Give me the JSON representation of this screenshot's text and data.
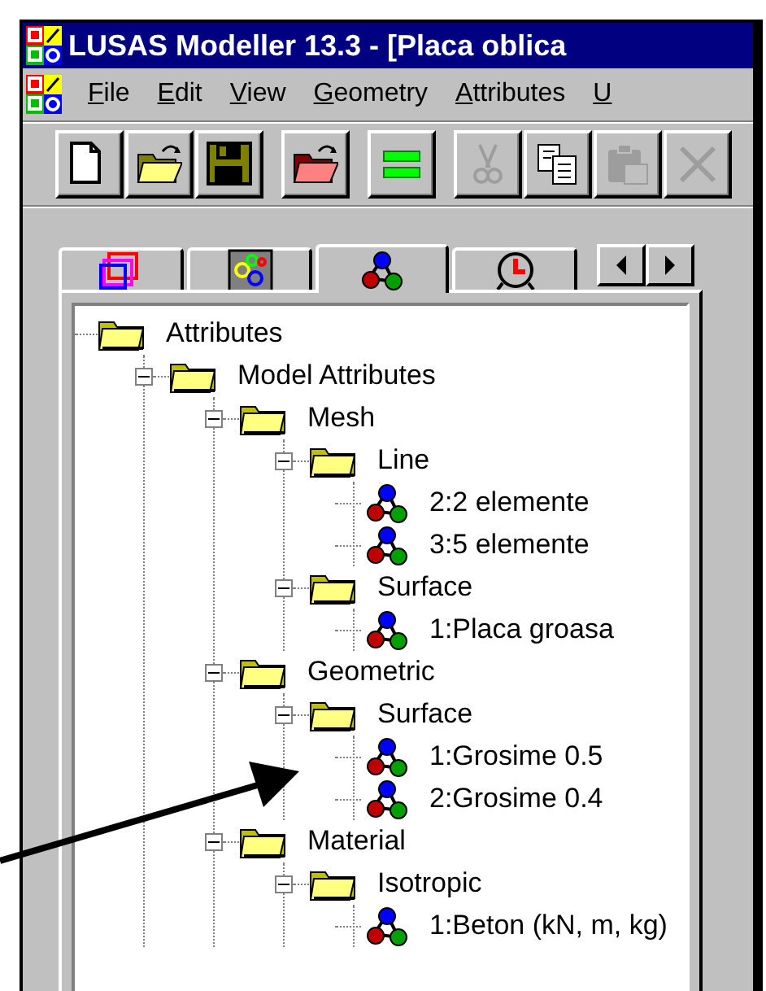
{
  "window": {
    "title": "LUSAS Modeller 13.3 - [Placa oblica"
  },
  "menu": [
    "File",
    "Edit",
    "View",
    "Geometry",
    "Attributes",
    "U"
  ],
  "toolbar": [
    [
      {
        "kind": "new",
        "disabled": false
      },
      {
        "kind": "open",
        "disabled": false
      },
      {
        "kind": "save",
        "disabled": false
      }
    ],
    [
      {
        "kind": "load",
        "disabled": false
      }
    ],
    [
      {
        "kind": "equals",
        "disabled": false
      }
    ],
    [
      {
        "kind": "cut",
        "disabled": true
      },
      {
        "kind": "copy",
        "disabled": false
      },
      {
        "kind": "paste",
        "disabled": true
      },
      {
        "kind": "delete",
        "disabled": true
      }
    ]
  ],
  "tabs": [
    {
      "kind": "layers",
      "selected": false
    },
    {
      "kind": "groups",
      "selected": false
    },
    {
      "kind": "attributes",
      "selected": true
    },
    {
      "kind": "clock",
      "selected": false
    }
  ],
  "tree": {
    "label": "Attributes",
    "children": [
      {
        "label": "Model Attributes",
        "kind": "folder",
        "expanded": true,
        "children": [
          {
            "label": "Mesh",
            "kind": "folder",
            "expanded": true,
            "children": [
              {
                "label": "Line",
                "kind": "folder",
                "expanded": true,
                "children": [
                  {
                    "label": "2:2 elemente",
                    "kind": "attribute"
                  },
                  {
                    "label": "3:5 elemente",
                    "kind": "attribute"
                  }
                ]
              },
              {
                "label": "Surface",
                "kind": "folder",
                "expanded": true,
                "children": [
                  {
                    "label": "1:Placa groasa",
                    "kind": "attribute"
                  }
                ]
              }
            ]
          },
          {
            "label": "Geometric",
            "kind": "folder",
            "expanded": true,
            "children": [
              {
                "label": "Surface",
                "kind": "folder",
                "expanded": true,
                "children": [
                  {
                    "label": "1:Grosime 0.5",
                    "kind": "attribute"
                  },
                  {
                    "label": "2:Grosime 0.4",
                    "kind": "attribute"
                  }
                ]
              }
            ]
          },
          {
            "label": "Material",
            "kind": "folder",
            "expanded": true,
            "children": [
              {
                "label": "Isotropic",
                "kind": "folder",
                "expanded": true,
                "children": [
                  {
                    "label": "1:Beton (kN, m, kg)",
                    "kind": "attribute"
                  }
                ]
              }
            ]
          }
        ]
      }
    ]
  }
}
